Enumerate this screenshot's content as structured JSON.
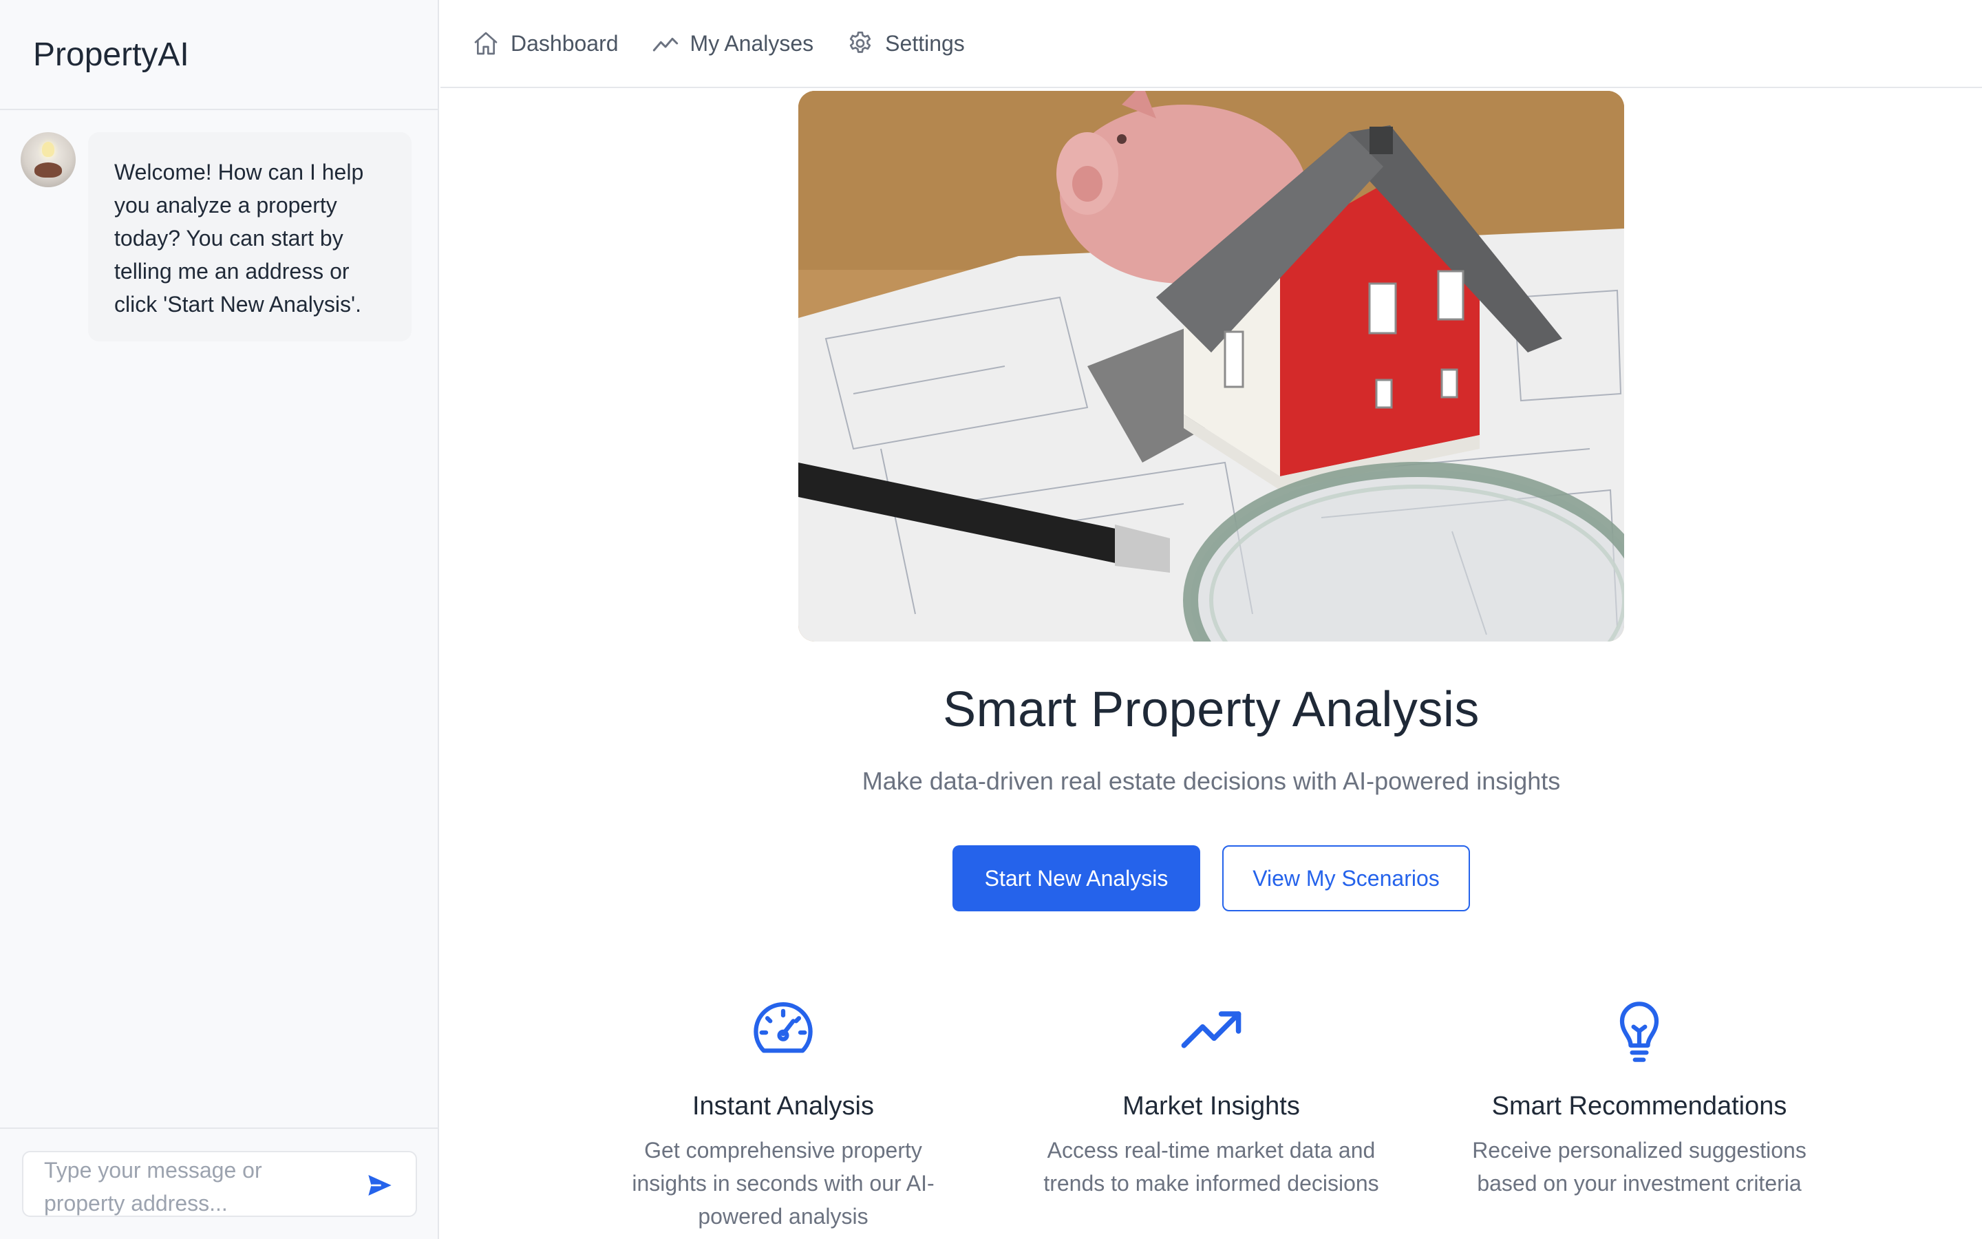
{
  "app": {
    "brand": "PropertyAI"
  },
  "nav": {
    "items": [
      {
        "label": "Dashboard",
        "icon": "home-icon"
      },
      {
        "label": "My Analyses",
        "icon": "trend-icon"
      },
      {
        "label": "Settings",
        "icon": "gear-icon"
      }
    ]
  },
  "chat": {
    "welcome": "Welcome! How can I help you analyze a property today? You can start by telling me an address or click 'Start New Analysis'.",
    "input_placeholder": "Type your message or property address..."
  },
  "hero": {
    "image_alt": "house model on blueprints with magnifying glass and piggy bank",
    "title": "Smart Property Analysis",
    "subtitle": "Make data-driven real estate decisions with AI-powered insights",
    "primary_button": "Start New Analysis",
    "secondary_button": "View My Scenarios"
  },
  "features": [
    {
      "icon": "speedometer-icon",
      "title": "Instant Analysis",
      "description": "Get comprehensive property insights in seconds with our AI-powered analysis"
    },
    {
      "icon": "trending-up-icon",
      "title": "Market Insights",
      "description": "Access real-time market data and trends to make informed decisions"
    },
    {
      "icon": "lightbulb-icon",
      "title": "Smart Recommendations",
      "description": "Receive personalized suggestions based on your investment criteria"
    }
  ],
  "colors": {
    "accent": "#2563eb",
    "sidebar_bg": "#f8f9fb",
    "text": "#1f2937",
    "muted": "#6b7280"
  }
}
